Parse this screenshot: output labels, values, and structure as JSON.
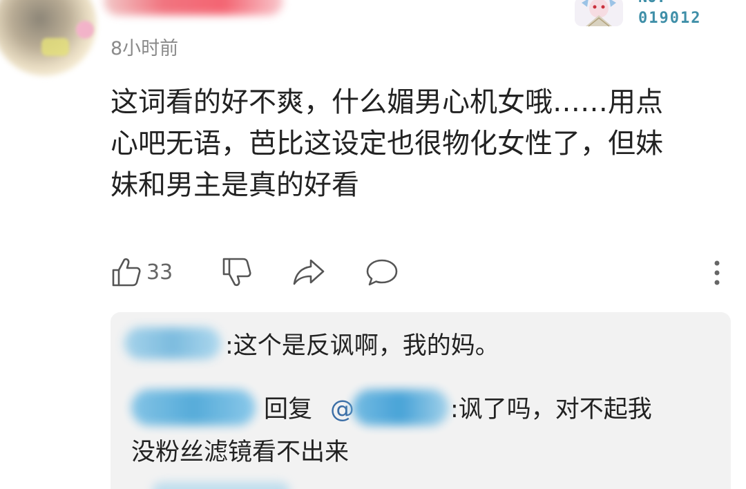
{
  "comment": {
    "timestamp": "8小时前",
    "medal": {
      "label": "NO.",
      "code": "019012"
    },
    "content_lines": [
      "这词看的好不爽，什么媚男心机女哦……用点",
      "心吧无语，芭比这设定也很物化女性了，但妹",
      "妹和男主是真的好看"
    ],
    "actions": {
      "like_count": "33",
      "like_icon": "thumbs-up-icon",
      "dislike_icon": "thumbs-down-icon",
      "share_icon": "share-icon",
      "reply_icon": "comment-icon",
      "more_icon": "more-vertical-icon"
    }
  },
  "replies": [
    {
      "text": ":这个是反讽啊，我的妈。"
    },
    {
      "reply_label": "回复",
      "mention_prefix": "@",
      "text_line1": ":讽了吗，对不起我",
      "text_line2": "没粉丝滤镜看不出来"
    }
  ],
  "colors": {
    "text": "#222222",
    "muted": "#8a8a8a",
    "reply_background": "#f2f2f2",
    "medal": "#3f8fa8"
  }
}
